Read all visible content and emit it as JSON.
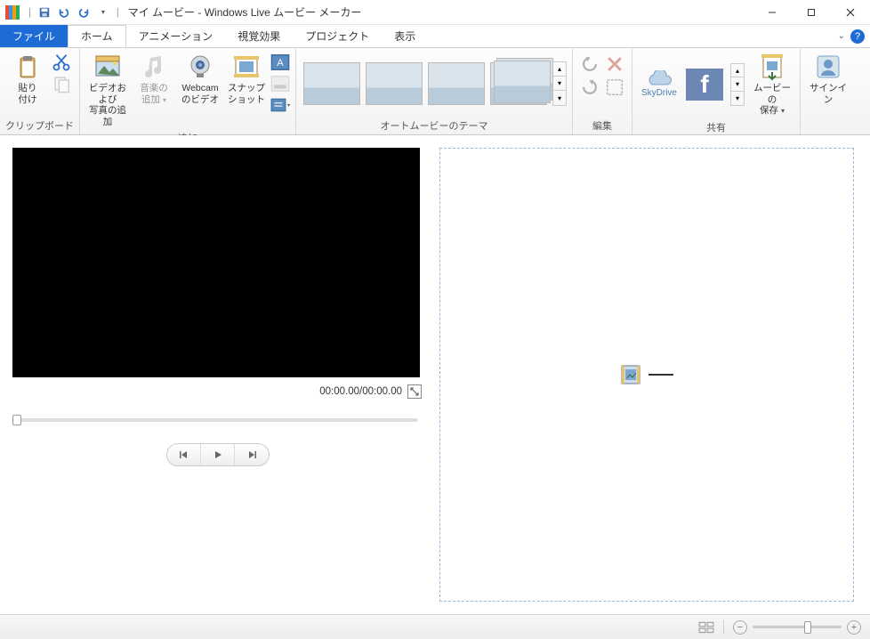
{
  "window": {
    "title": "マイ ムービー - Windows Live ムービー メーカー"
  },
  "tabs": {
    "file": "ファイル",
    "home": "ホーム",
    "animation": "アニメーション",
    "visual_effects": "視覚効果",
    "project": "プロジェクト",
    "view": "表示"
  },
  "ribbon": {
    "clipboard": {
      "paste": "貼り\n付け",
      "label": "クリップボード"
    },
    "add": {
      "video_photo": "ビデオおよび\n写真の追加",
      "music": "音楽の\n追加",
      "webcam": "Webcam\nのビデオ",
      "snapshot": "スナップ\nショット",
      "label": "追加"
    },
    "themes": {
      "label": "オートムービーのテーマ"
    },
    "edit": {
      "label": "編集"
    },
    "share": {
      "skydrive": "SkyDrive",
      "save_movie": "ムービーの\n保存",
      "label": "共有"
    },
    "signin": {
      "label": "サインイン"
    }
  },
  "preview": {
    "time": "00:00.00/00:00.00"
  },
  "icons": {
    "minimize": "minimize",
    "maximize": "maximize",
    "close": "close"
  }
}
